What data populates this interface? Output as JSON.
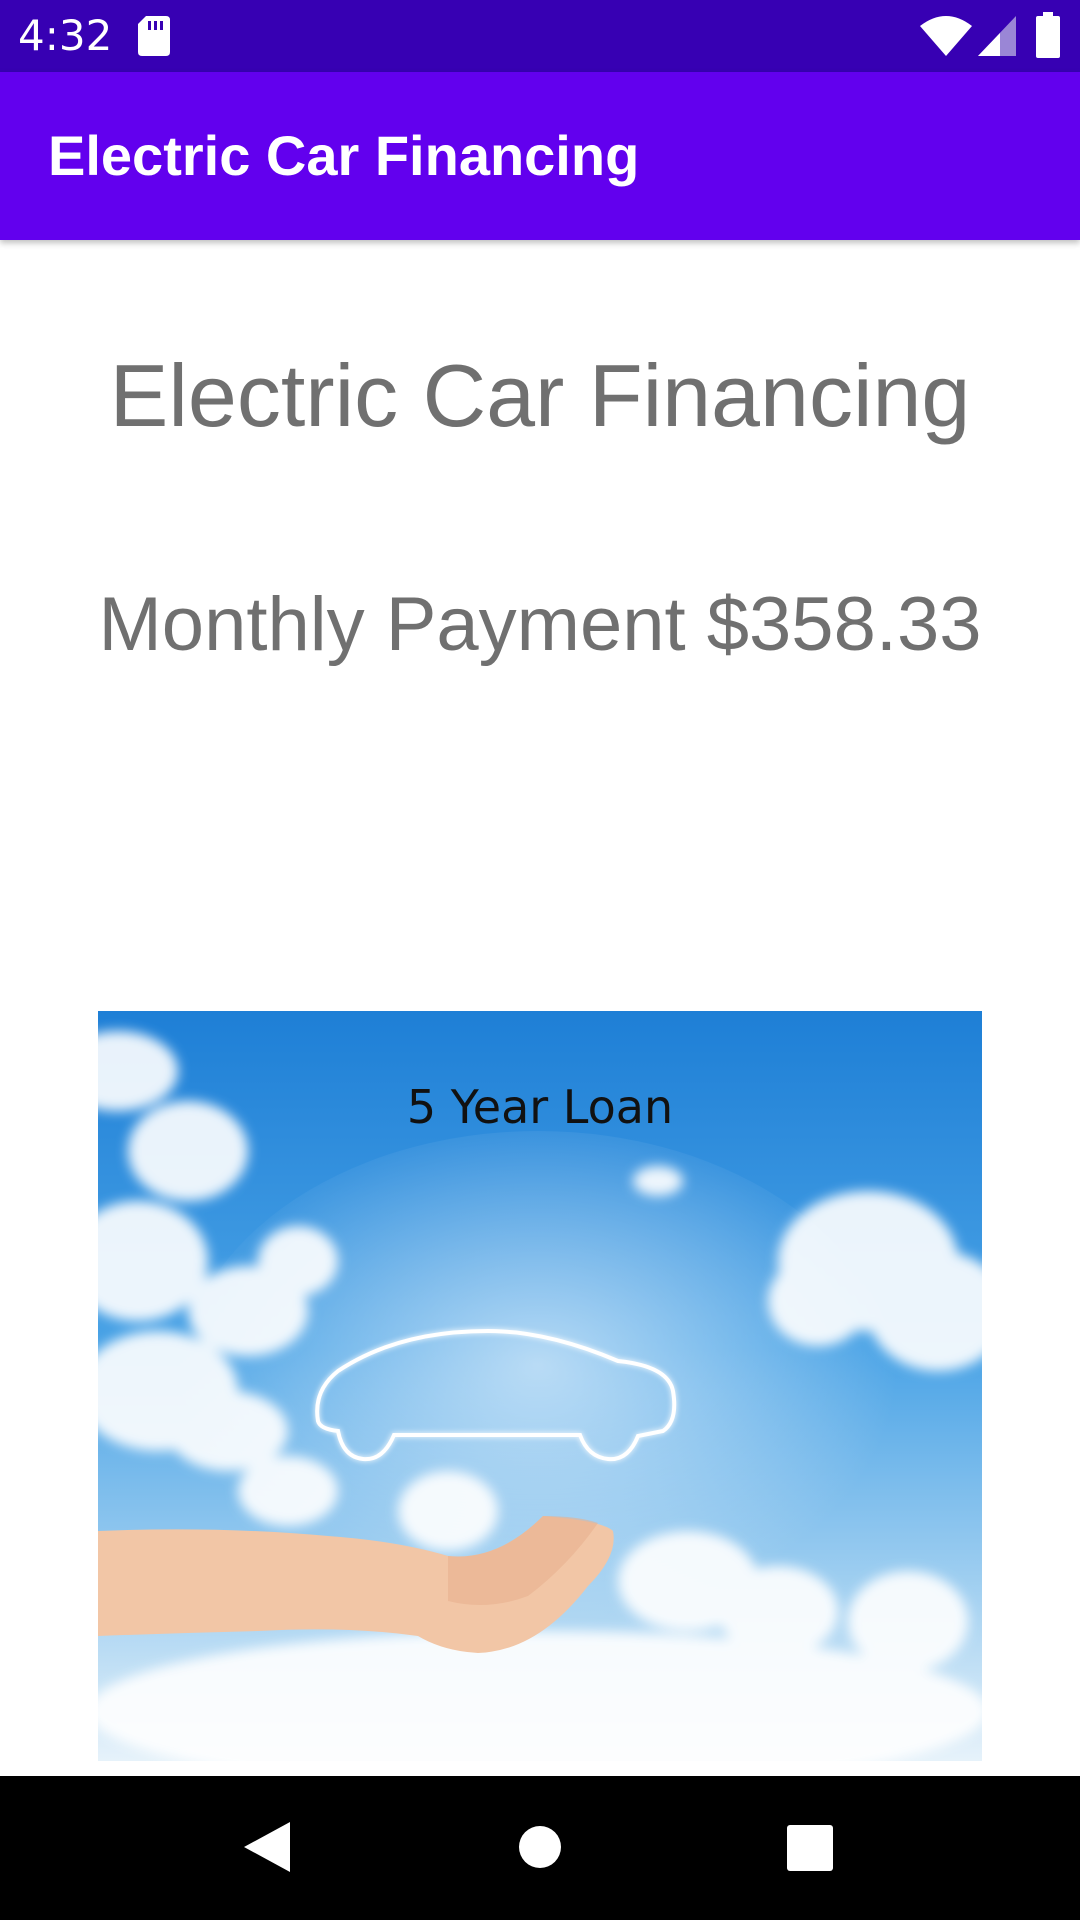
{
  "status_bar": {
    "time": "4:32",
    "icons": [
      "sd-card-icon",
      "wifi-icon",
      "cell-signal-icon",
      "battery-icon"
    ]
  },
  "app_bar": {
    "title": "Electric Car Financing"
  },
  "main": {
    "heading": "Electric Car Financing",
    "monthly_payment": "Monthly Payment $358.33",
    "image": {
      "caption": "5 Year Loan"
    }
  },
  "nav_bar": {
    "icons": [
      "back-icon",
      "home-icon",
      "recents-icon"
    ]
  },
  "colors": {
    "status_bar": "#3700b3",
    "app_bar": "#6200ee",
    "text": "#707070",
    "sky_top": "#1e7fd6",
    "sky_bottom": "#d9ecf8"
  }
}
